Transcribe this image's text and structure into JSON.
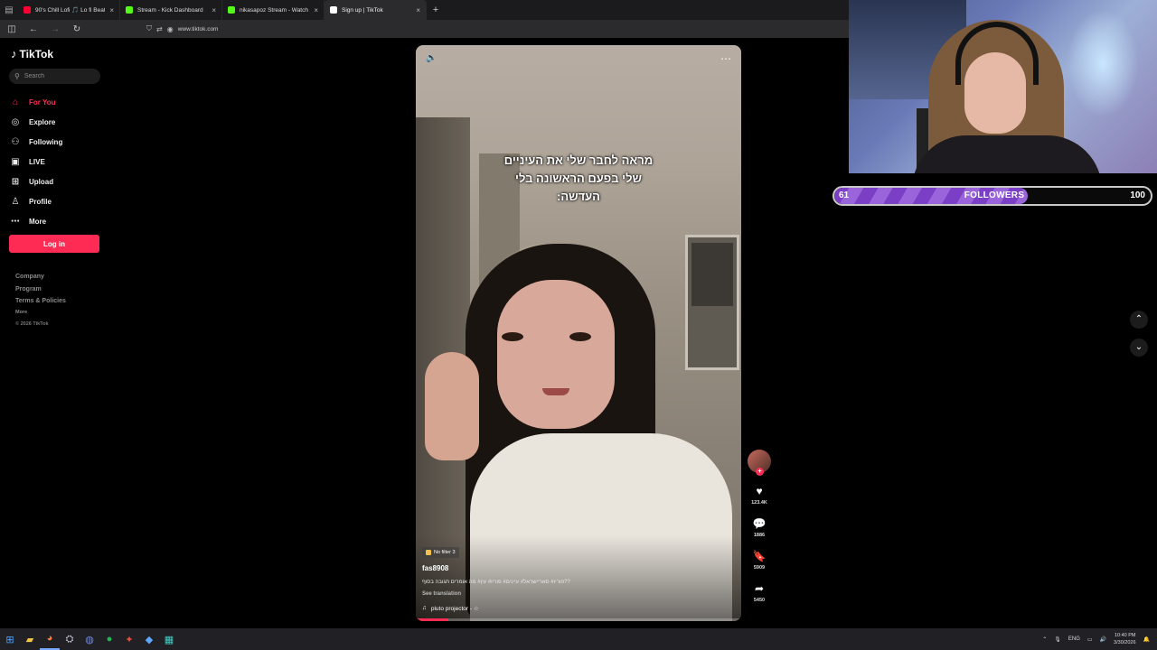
{
  "browser": {
    "tabs": [
      {
        "title": "90's Chill Lofi 🎵 Lo fi Beat",
        "color": "#ff0033",
        "active": false
      },
      {
        "title": "Stream - Kick Dashboard",
        "color": "#53fc18",
        "active": false
      },
      {
        "title": "nikasapoz Stream - Watch Live",
        "color": "#53fc18",
        "active": false
      },
      {
        "title": "Sign up | TikTok",
        "color": "#ffffff",
        "active": true
      }
    ],
    "url": "www.tiktok.com"
  },
  "sidebar": {
    "logo": "TikTok",
    "search_placeholder": "Search",
    "items": [
      {
        "label": "For You",
        "icon": "home-icon",
        "glyph": "⌂",
        "active": true
      },
      {
        "label": "Explore",
        "icon": "compass-icon",
        "glyph": "◎",
        "active": false
      },
      {
        "label": "Following",
        "icon": "following-icon",
        "glyph": "⚇",
        "active": false
      },
      {
        "label": "LIVE",
        "icon": "live-icon",
        "glyph": "▣",
        "active": false
      },
      {
        "label": "Upload",
        "icon": "upload-icon",
        "glyph": "⊞",
        "active": false
      },
      {
        "label": "Profile",
        "icon": "profile-icon",
        "glyph": "♙",
        "active": false
      },
      {
        "label": "More",
        "icon": "more-dots-icon",
        "glyph": "⋯",
        "active": false
      }
    ],
    "login_label": "Log in",
    "footer": [
      "Company",
      "Program",
      "Terms & Policies"
    ],
    "footer_more": "More",
    "copyright": "© 2026 TikTok"
  },
  "video": {
    "overlay_text_lines": [
      "מראה לחבר שלי את העיניים",
      "שלי בפעם הראשונה בלי",
      "העדשה:"
    ],
    "filter_label": "No filter 3",
    "username": "fas8908",
    "caption": "פוריו# סאריישראל# עיינים# פוריו# עין# מה אומרים תגובה בסוף??",
    "see_translation": "See translation",
    "music": "pluto projector - ☆",
    "progress": 0.1
  },
  "actions": {
    "likes": "123.4K",
    "comments": "1886",
    "saves": "5909",
    "shares": "5450"
  },
  "followers_goal": {
    "current": "61",
    "label": "FOLLOWERS",
    "target": "100",
    "progress": 0.61
  },
  "taskbar": {
    "lang": "ENG",
    "time": "10:40 PM",
    "date": "3/30/2026"
  },
  "colors": {
    "accent": "#fe2c55",
    "followers_bar": "#7a3fc4"
  }
}
